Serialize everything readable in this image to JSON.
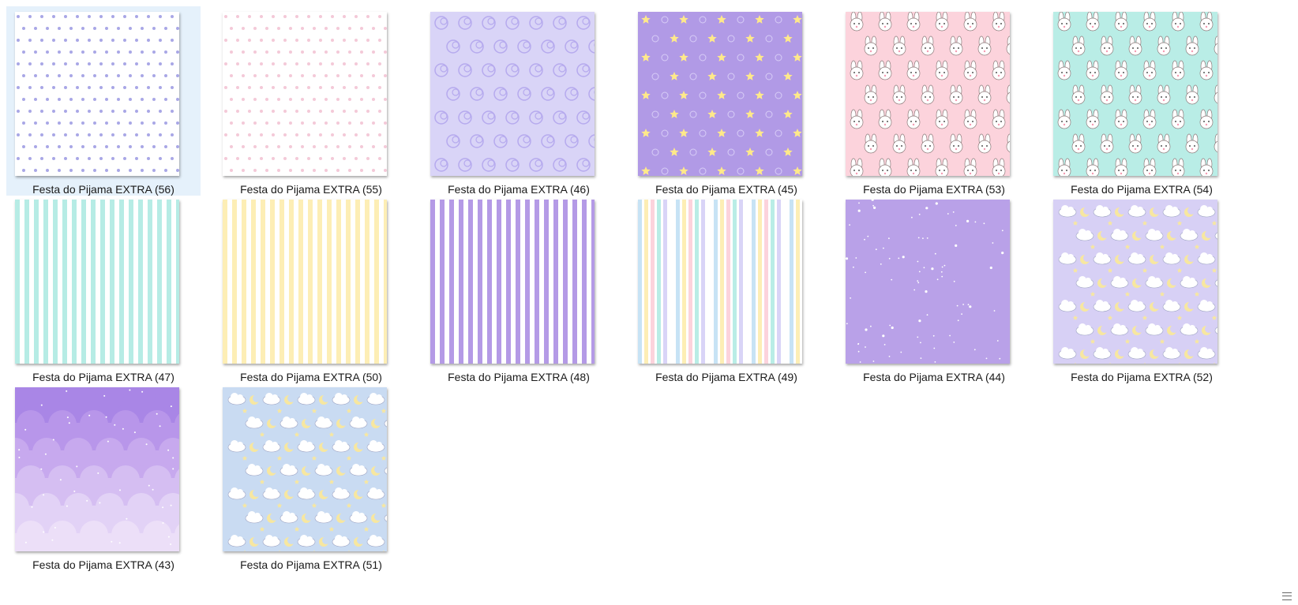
{
  "explorer": {
    "items": [
      {
        "name": "Festa do Pijama EXTRA (56)",
        "pattern": "dots",
        "selected": true,
        "colors": {
          "bg": "#ffffff",
          "fg": "#a9a7e6"
        }
      },
      {
        "name": "Festa do Pijama EXTRA (55)",
        "pattern": "dots",
        "selected": false,
        "colors": {
          "bg": "#ffffff",
          "fg": "#f4c9d8"
        }
      },
      {
        "name": "Festa do Pijama EXTRA (46)",
        "pattern": "swirls",
        "selected": false,
        "colors": {
          "bg": "#d9d4f7",
          "fg": "#b6aaee"
        }
      },
      {
        "name": "Festa do Pijama EXTRA (45)",
        "pattern": "stars",
        "selected": false,
        "colors": {
          "bg": "#b19ae6",
          "fg": "#ffe98a"
        }
      },
      {
        "name": "Festa do Pijama EXTRA (53)",
        "pattern": "bunnies",
        "selected": false,
        "colors": {
          "bg": "#fcd3dc",
          "fg": "#ffffff"
        }
      },
      {
        "name": "Festa do Pijama EXTRA (54)",
        "pattern": "bunnies",
        "selected": false,
        "colors": {
          "bg": "#b9ede6",
          "fg": "#ffffff"
        }
      },
      {
        "name": "Festa do Pijama EXTRA (47)",
        "pattern": "stripes",
        "selected": false,
        "colors": {
          "bg": "#ffffff",
          "fg": "#b6ece5"
        }
      },
      {
        "name": "Festa do Pijama EXTRA (50)",
        "pattern": "stripes",
        "selected": false,
        "colors": {
          "bg": "#ffffff",
          "fg": "#fdeeb5"
        }
      },
      {
        "name": "Festa do Pijama EXTRA (48)",
        "pattern": "stripes",
        "selected": false,
        "colors": {
          "bg": "#ffffff",
          "fg": "#b49ae6"
        }
      },
      {
        "name": "Festa do Pijama EXTRA (49)",
        "pattern": "multistripes",
        "selected": false,
        "colors": {
          "bg": "#ffffff",
          "fg": "#c7e3f5"
        }
      },
      {
        "name": "Festa do Pijama EXTRA (44)",
        "pattern": "sparkle",
        "selected": false,
        "colors": {
          "bg": "#b9a1e8",
          "fg": "#ffffff"
        }
      },
      {
        "name": "Festa do Pijama EXTRA (52)",
        "pattern": "clouds",
        "selected": false,
        "colors": {
          "bg": "#d7d0f5",
          "fg": "#ffffff"
        }
      },
      {
        "name": "Festa do Pijama EXTRA (43)",
        "pattern": "skyclouds",
        "selected": false,
        "colors": {
          "bg": "#a986e6",
          "fg": "#e7dcfa"
        }
      },
      {
        "name": "Festa do Pijama EXTRA (51)",
        "pattern": "clouds",
        "selected": false,
        "colors": {
          "bg": "#c9dbf2",
          "fg": "#ffffff"
        }
      }
    ],
    "resize_icon": "resize-grip-icon"
  }
}
